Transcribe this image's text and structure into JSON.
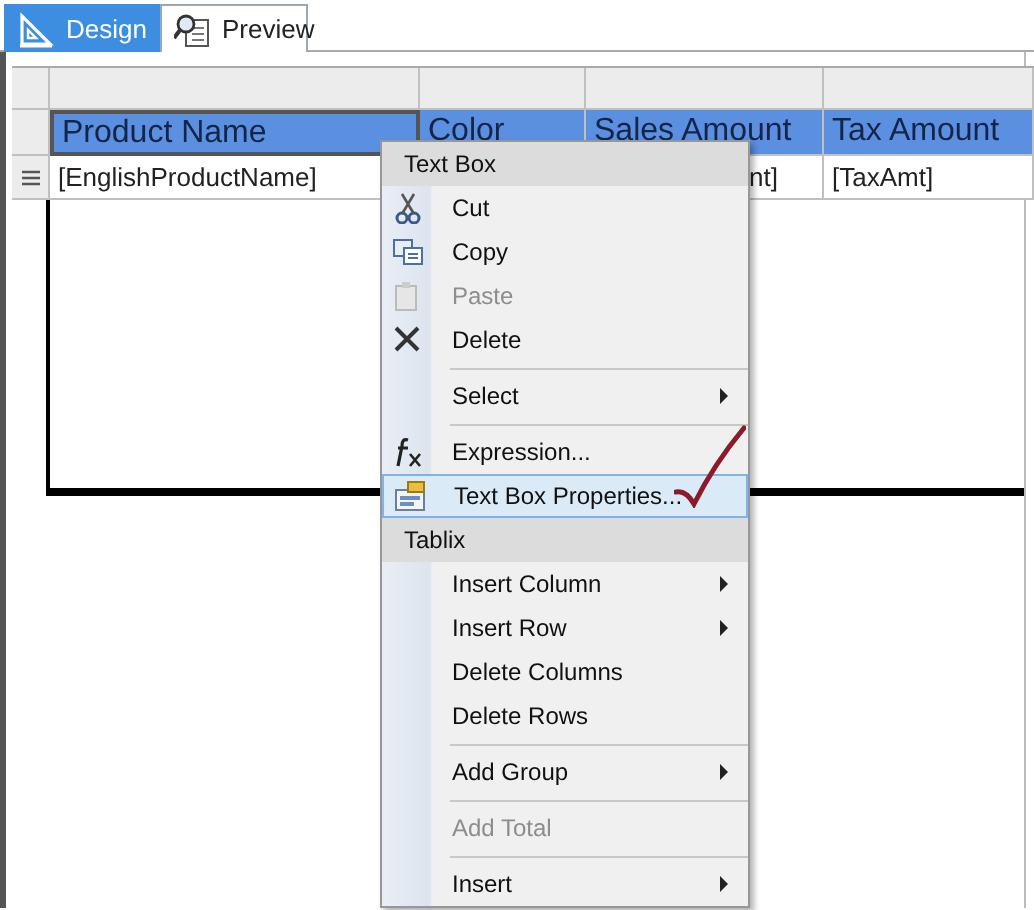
{
  "tabs": [
    {
      "label": "Design",
      "selected": true
    },
    {
      "label": "Preview",
      "selected": false
    }
  ],
  "table": {
    "columns": [
      {
        "header": "Product Name",
        "selected": true,
        "value": "[EnglishProductName]"
      },
      {
        "header": "Color",
        "selected": false
      },
      {
        "header": "Sales Amount",
        "selected": false,
        "value": "nt]"
      },
      {
        "header": "Tax Amount",
        "selected": false,
        "value": "[TaxAmt]"
      }
    ]
  },
  "context_menu": {
    "items": [
      {
        "kind": "header",
        "label": "Text Box"
      },
      {
        "kind": "item",
        "label": "Cut",
        "disabled": false,
        "submenu": false,
        "selected": false
      },
      {
        "kind": "item",
        "label": "Copy",
        "disabled": false,
        "submenu": false,
        "selected": false
      },
      {
        "kind": "item",
        "label": "Paste",
        "disabled": true,
        "submenu": false,
        "selected": false
      },
      {
        "kind": "item",
        "label": "Delete",
        "disabled": false,
        "submenu": false,
        "selected": false
      },
      {
        "kind": "separator"
      },
      {
        "kind": "item",
        "label": "Select",
        "disabled": false,
        "submenu": true,
        "selected": false
      },
      {
        "kind": "separator"
      },
      {
        "kind": "item",
        "label": "Expression...",
        "disabled": false,
        "submenu": false,
        "selected": false
      },
      {
        "kind": "item",
        "label": "Text Box Properties...",
        "disabled": false,
        "submenu": false,
        "selected": true
      },
      {
        "kind": "header",
        "label": "Tablix"
      },
      {
        "kind": "item",
        "label": "Insert Column",
        "disabled": false,
        "submenu": true,
        "selected": false
      },
      {
        "kind": "item",
        "label": "Insert Row",
        "disabled": false,
        "submenu": true,
        "selected": false
      },
      {
        "kind": "item",
        "label": "Delete Columns",
        "disabled": false,
        "submenu": false,
        "selected": false
      },
      {
        "kind": "item",
        "label": "Delete Rows",
        "disabled": false,
        "submenu": false,
        "selected": false
      },
      {
        "kind": "separator"
      },
      {
        "kind": "item",
        "label": "Add Group",
        "disabled": false,
        "submenu": true,
        "selected": false
      },
      {
        "kind": "separator"
      },
      {
        "kind": "item",
        "label": "Add Total",
        "disabled": true,
        "submenu": false,
        "selected": false
      },
      {
        "kind": "separator"
      },
      {
        "kind": "item",
        "label": "Insert",
        "disabled": false,
        "submenu": true,
        "selected": false
      }
    ]
  }
}
